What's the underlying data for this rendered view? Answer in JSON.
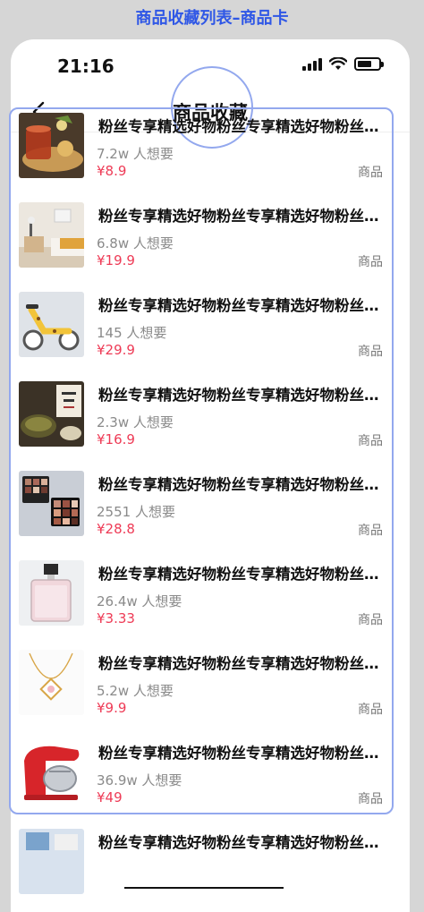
{
  "annotation_title": "商品收藏列表–商品卡",
  "status_bar": {
    "time": "21:16"
  },
  "nav": {
    "title": "商品收藏"
  },
  "products": [
    {
      "title": "粉丝专享精选好物粉丝专享精选好物粉丝专享精选好物",
      "wants": "7.2w 人想要",
      "price": "¥8.9",
      "tag": "商品",
      "image": "dessert-tea"
    },
    {
      "title": "粉丝专享精选好物粉丝专享精选好物粉丝专享精选好物",
      "wants": "6.8w 人想要",
      "price": "¥19.9",
      "tag": "商品",
      "image": "bedroom"
    },
    {
      "title": "粉丝专享精选好物粉丝专享精选好物粉丝专享精选好物",
      "wants": "145 人想要",
      "price": "¥29.9",
      "tag": "商品",
      "image": "balance-bike"
    },
    {
      "title": "粉丝专享精选好物粉丝专享精选好物粉丝专享精选好物",
      "wants": "2.3w 人想要",
      "price": "¥16.9",
      "tag": "商品",
      "image": "tea-leaves"
    },
    {
      "title": "粉丝专享精选好物粉丝专享精选好物粉丝专享精选好物",
      "wants": "2551 人想要",
      "price": "¥28.8",
      "tag": "商品",
      "image": "eyeshadow"
    },
    {
      "title": "粉丝专享精选好物粉丝专享精选好物粉丝专享精选好物",
      "wants": "26.4w 人想要",
      "price": "¥3.33",
      "tag": "商品",
      "image": "perfume"
    },
    {
      "title": "粉丝专享精选好物粉丝专享精选好物粉丝专享精选好物",
      "wants": "5.2w 人想要",
      "price": "¥9.9",
      "tag": "商品",
      "image": "necklace"
    },
    {
      "title": "粉丝专享精选好物粉丝专享精选好物粉丝专享精选好物",
      "wants": "36.9w 人想要",
      "price": "¥49",
      "tag": "商品",
      "image": "stand-mixer"
    },
    {
      "title": "粉丝专享精选好物粉丝专享精选好物粉丝专享精选好物",
      "wants": "",
      "price": "",
      "tag": "",
      "image": "partial-item"
    }
  ],
  "colors": {
    "annotation": "#2f57e6",
    "highlight": "#93a8ee",
    "price": "#ee3b56"
  }
}
